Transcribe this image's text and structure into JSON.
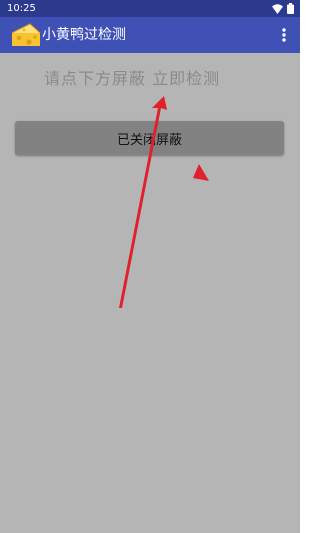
{
  "status_bar": {
    "time": "10:25",
    "icons": [
      "wifi-icon",
      "battery-icon"
    ]
  },
  "app_bar": {
    "title": "小黄鸭过检测",
    "logo_icon": "cheese-icon",
    "menu_icon": "more-vert-icon",
    "background_color": "#3f51b5"
  },
  "main": {
    "instruction": "请点下方屏蔽  立即检测",
    "button_label": "已关闭屏蔽"
  },
  "annotation": {
    "arrow_color": "#e0202a"
  }
}
